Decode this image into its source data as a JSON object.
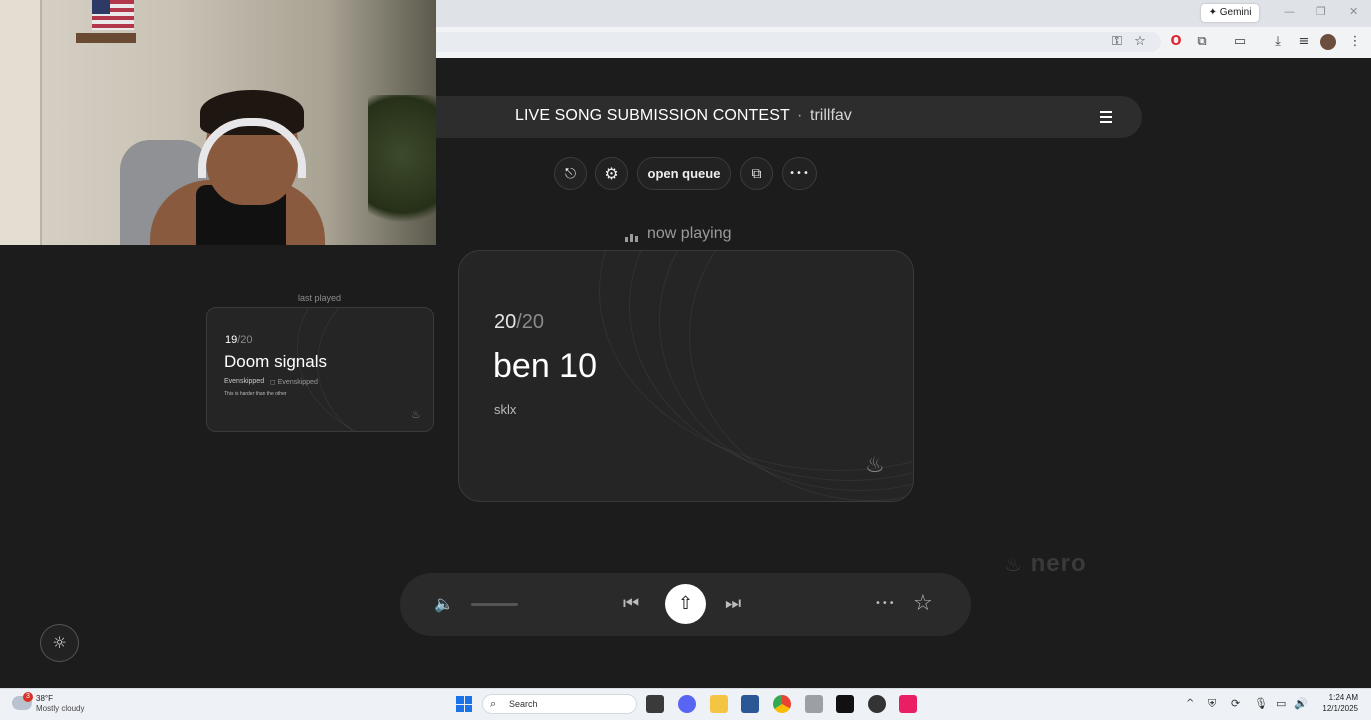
{
  "browser": {
    "gemini_label": "✦ Gemini",
    "window_controls": [
      "—",
      "❐",
      "✕"
    ],
    "icons": [
      "key-icon",
      "star-icon",
      "opera-icon",
      "extensions-icon",
      "sidepanel-icon",
      "download-icon",
      "media-icon",
      "profile-icon",
      "kebab-icon"
    ]
  },
  "app": {
    "title": "LIVE SONG SUBMISSION CONTEST",
    "separator": "·",
    "host": "trillfav",
    "toolbar": {
      "exit_icon": "⎋",
      "settings_icon": "⚙",
      "open_queue_label": "open queue",
      "share_icon": "⧉",
      "more_icon": "•••"
    },
    "now_playing_label": "now playing",
    "last_played_label": "last played",
    "last_card": {
      "index": "19",
      "total": "/20",
      "song": "Doom signals",
      "artist": "Evenskipped",
      "handle": "Evenskipped",
      "note": "This is harder than the other"
    },
    "now_card": {
      "index": "20",
      "total": "/20",
      "song": "ben 10",
      "artist": "sklx"
    },
    "watermark": "nero",
    "player": {
      "volume_icon": "🔈",
      "prev_icon": "⏮",
      "upload_icon": "⇧",
      "next_icon": "⏭",
      "more_icon": "•••",
      "star_icon": "☆"
    },
    "theme_icon": "☼"
  },
  "taskbar": {
    "weather_temp": "38°F",
    "weather_desc": "Mostly cloudy",
    "weather_badge": "3",
    "search_label": "Search",
    "time": "1:24 AM",
    "date": "12/1/2025"
  }
}
